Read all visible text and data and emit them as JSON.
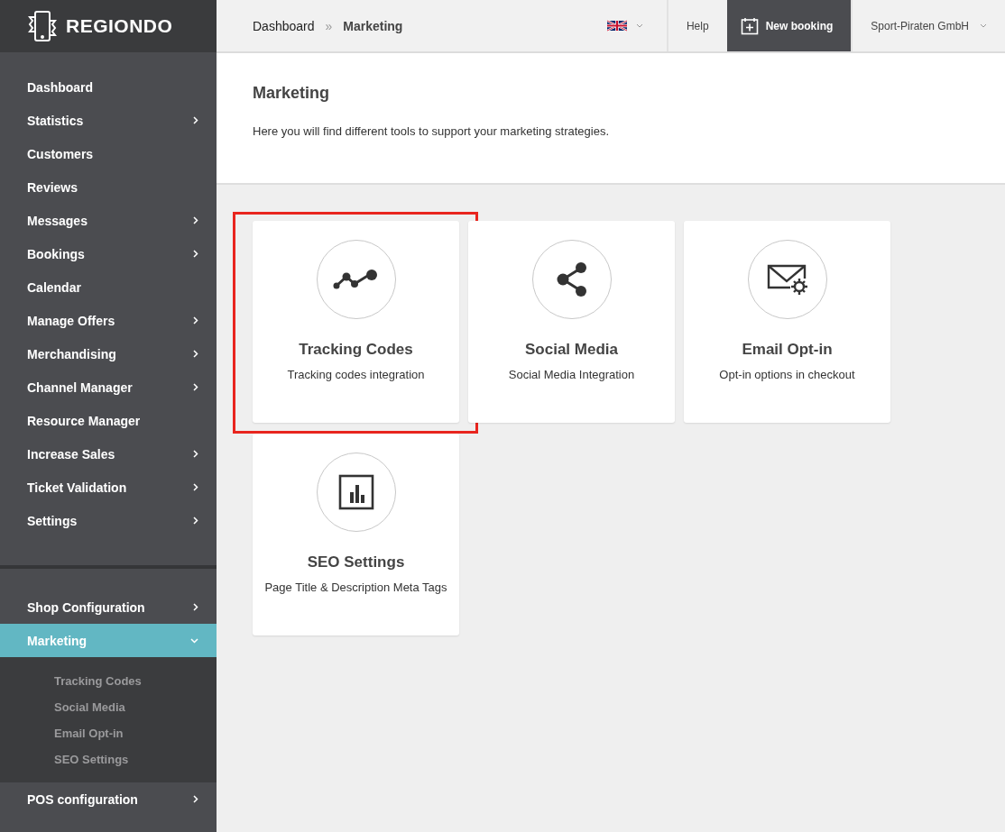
{
  "brand": {
    "name": "REGIONDO"
  },
  "breadcrumb": [
    {
      "label": "Dashboard",
      "separator": "»"
    },
    {
      "label": "Marketing"
    }
  ],
  "topbar": {
    "help": "Help",
    "new_booking": "New booking",
    "account": "Sport-Piraten GmbH"
  },
  "sidebar": {
    "items": [
      {
        "label": "Dashboard",
        "has_submenu": false
      },
      {
        "label": "Statistics",
        "has_submenu": true
      },
      {
        "label": "Customers",
        "has_submenu": false
      },
      {
        "label": "Reviews",
        "has_submenu": false
      },
      {
        "label": "Messages",
        "has_submenu": true
      },
      {
        "label": "Bookings",
        "has_submenu": true
      },
      {
        "label": "Calendar",
        "has_submenu": false
      },
      {
        "label": "Manage Offers",
        "has_submenu": true
      },
      {
        "label": "Merchandising",
        "has_submenu": true
      },
      {
        "label": "Channel Manager",
        "has_submenu": true
      },
      {
        "label": "Resource Manager",
        "has_submenu": false
      },
      {
        "label": "Increase Sales",
        "has_submenu": true
      },
      {
        "label": "Ticket Validation",
        "has_submenu": true
      },
      {
        "label": "Settings",
        "has_submenu": true
      }
    ],
    "lower_items": [
      {
        "label": "Shop Configuration",
        "has_submenu": true,
        "selected": false,
        "expanded": false
      },
      {
        "label": "Marketing",
        "has_submenu": true,
        "selected": true,
        "expanded": true,
        "children": [
          {
            "label": "Tracking Codes"
          },
          {
            "label": "Social Media"
          },
          {
            "label": "Email Opt-in"
          },
          {
            "label": "SEO Settings"
          }
        ]
      },
      {
        "label": "POS configuration",
        "has_submenu": true,
        "selected": false,
        "expanded": false
      }
    ]
  },
  "page": {
    "title": "Marketing",
    "description": "Here you will find different tools to support your marketing strategies."
  },
  "cards": [
    {
      "kind": "tracking",
      "title": "Tracking Codes",
      "subtitle": "Tracking codes integration",
      "highlighted": true
    },
    {
      "kind": "share",
      "title": "Social Media",
      "subtitle": "Social Media Integration",
      "highlighted": false
    },
    {
      "kind": "email",
      "title": "Email Opt-in",
      "subtitle": "Opt-in options in checkout",
      "highlighted": false
    },
    {
      "kind": "seo",
      "title": "SEO Settings",
      "subtitle": "Page Title & Description Meta Tags",
      "highlighted": false
    }
  ]
}
